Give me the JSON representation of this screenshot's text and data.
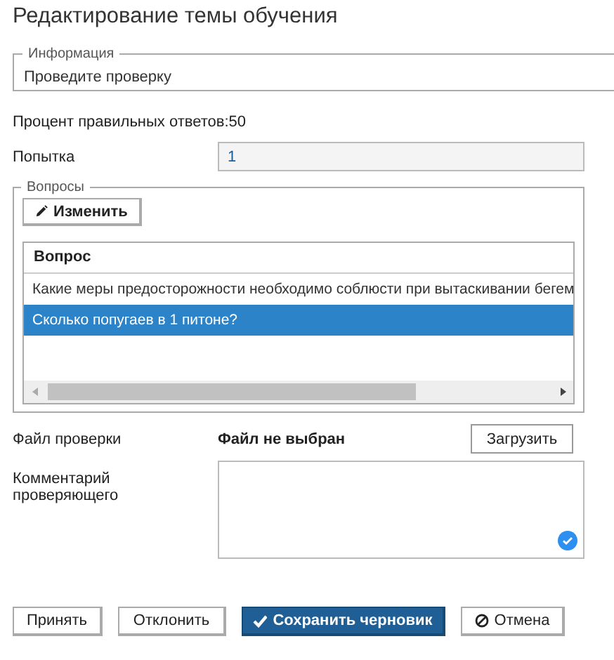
{
  "title": "Редактирование темы обучения",
  "info": {
    "legend": "Информация",
    "text": "Проведите проверку"
  },
  "percent": "Процент правильных ответов:50",
  "attempt": {
    "label": "Попытка",
    "value": "1"
  },
  "questions": {
    "legend": "Вопросы",
    "edit_button": "Изменить",
    "column": "Вопрос",
    "rows": [
      {
        "text": "Какие меры предосторожности необходимо соблюсти при вытаскивании бегем",
        "selected": false
      },
      {
        "text": "Сколько попугаев в 1 питоне?",
        "selected": true
      }
    ]
  },
  "file": {
    "label": "Файл проверки",
    "status": "Файл не выбран",
    "button": "Загрузить"
  },
  "comment": {
    "label": "Комментарий проверяющего"
  },
  "buttons": [
    {
      "label": "Принять",
      "kind": "plain"
    },
    {
      "label": "Отклонить",
      "kind": "plain"
    },
    {
      "label": "Сохранить черновик",
      "kind": "primary"
    },
    {
      "label": "Отмена",
      "kind": "cancel"
    }
  ]
}
